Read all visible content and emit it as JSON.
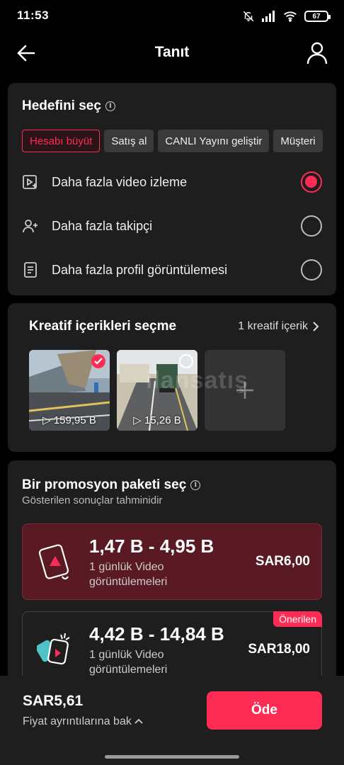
{
  "status": {
    "time": "11:53",
    "battery": "67"
  },
  "nav": {
    "title": "Tanıt"
  },
  "goal": {
    "title": "Hedefini seç",
    "chips": [
      "Hesabı büyüt",
      "Satış al",
      "CANLI Yayını geliştir",
      "Müşteri"
    ],
    "options": [
      {
        "label": "Daha fazla video izleme",
        "icon": "video-play-icon",
        "checked": true
      },
      {
        "label": "Daha fazla takipçi",
        "icon": "add-user-icon",
        "checked": false
      },
      {
        "label": "Daha fazla profil görüntülemesi",
        "icon": "document-icon",
        "checked": false
      }
    ]
  },
  "creative": {
    "title": "Kreatif içerikleri seçme",
    "link": "1 kreatif içerik",
    "videos": [
      {
        "views": "159,95 B",
        "selected": true
      },
      {
        "views": "15,26 B",
        "selected": false
      }
    ],
    "watermark": "ilansatış"
  },
  "package": {
    "title": "Bir promosyon paketi seç",
    "subtitle": "Gösterilen sonuçlar tahminidir",
    "items": [
      {
        "range": "1,47 B - 4,95 B",
        "desc": "1 günlük Video görüntülemeleri",
        "price": "SAR6,00",
        "selected": true
      },
      {
        "range": "4,42 B - 14,84 B",
        "desc": "1 günlük Video görüntülemeleri",
        "price": "SAR18,00",
        "badge": "Önerilen",
        "selected": false
      }
    ]
  },
  "footer": {
    "total": "SAR5,61",
    "details": "Fiyat ayrıntılarına bak",
    "pay": "Öde"
  },
  "colors": {
    "accent": "#fe2c55",
    "card": "#1e1e1e",
    "selected_package": "#5a1a23"
  }
}
